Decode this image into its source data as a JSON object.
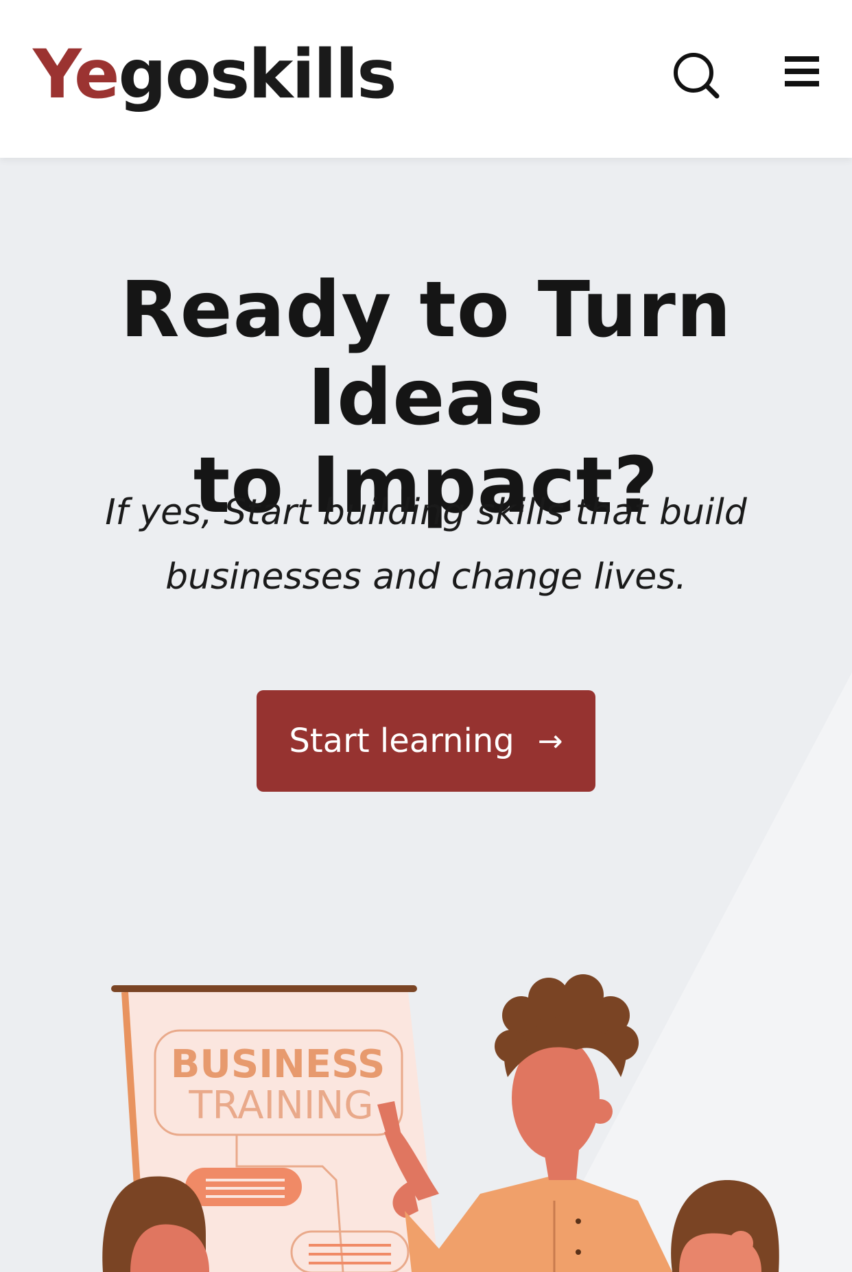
{
  "header": {
    "logo_prefix": "Ye",
    "logo_suffix": "goskills",
    "brand_color": "#9b3331",
    "search_icon": "search-icon",
    "menu_icon": "hamburger-menu-icon"
  },
  "hero": {
    "headline_line1": "Ready to Turn Ideas",
    "headline_line2": "to Impact?",
    "subline_line1": "If yes, Start building skills that build",
    "subline_line2": "businesses and change lives.",
    "cta_label": "Start learning",
    "cta_arrow": "→",
    "cta_color": "#963330"
  },
  "illustration": {
    "board_title_line1": "BUSINESS",
    "board_title_line2": "TRAINING"
  }
}
